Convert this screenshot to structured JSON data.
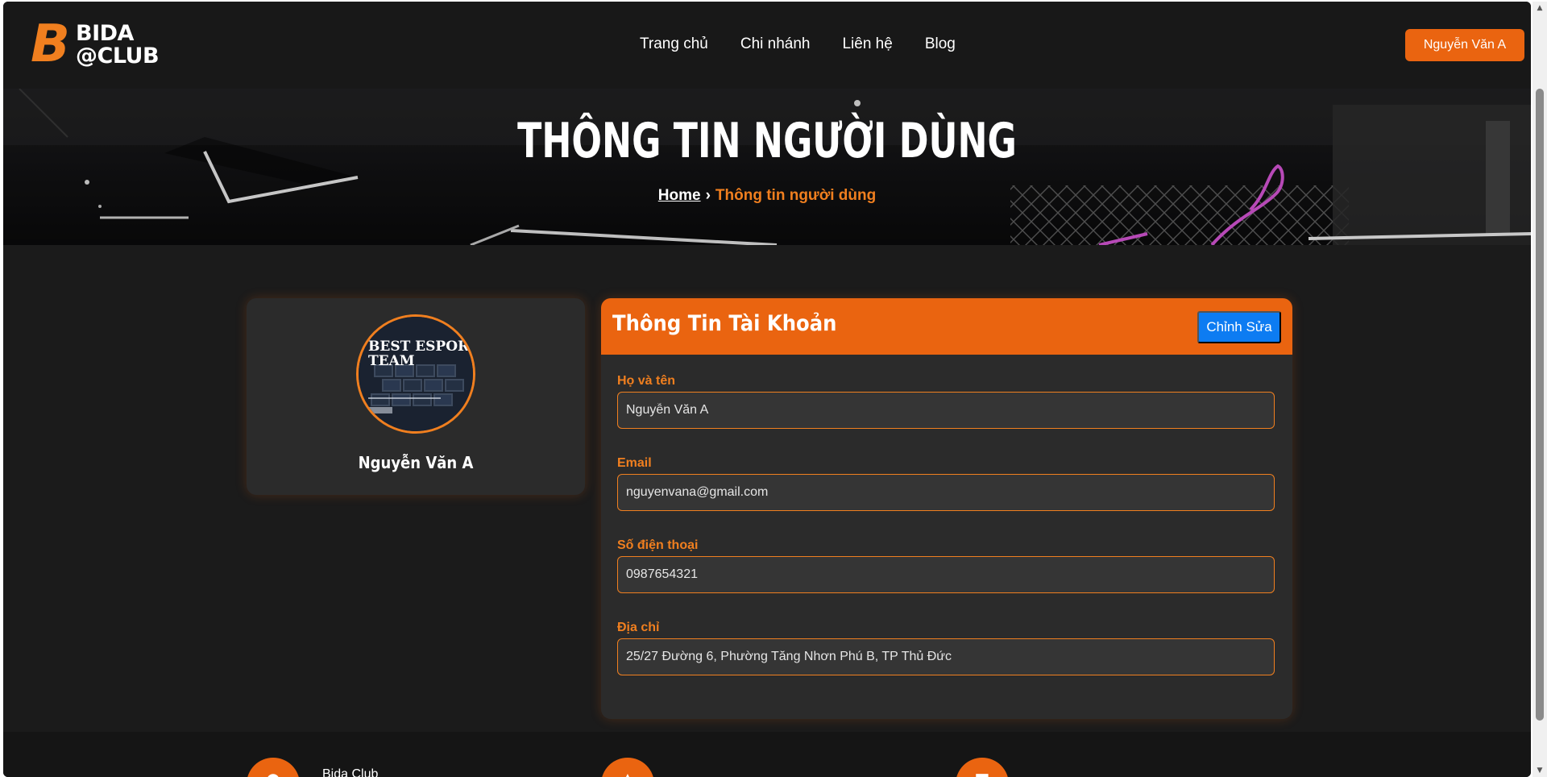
{
  "brand": {
    "logo_mark": "B",
    "logo_line1": "BIDA",
    "logo_line2": "@CLUB"
  },
  "nav": {
    "items": [
      {
        "label": "Trang chủ"
      },
      {
        "label": "Chi nhánh"
      },
      {
        "label": "Liên hệ"
      },
      {
        "label": "Blog"
      }
    ],
    "user_button": "Nguyễn Văn A"
  },
  "hero": {
    "title": "THÔNG TIN NGƯỜI DÙNG",
    "breadcrumb": {
      "home": "Home",
      "separator": "›",
      "current": "Thông tin người dùng"
    }
  },
  "profile": {
    "name": "Nguyễn Văn A",
    "avatar_text_line1": "BEST ESPORT",
    "avatar_text_line2": "TEAM"
  },
  "account": {
    "title": "Thông Tin Tài Khoản",
    "edit_button": "Chỉnh Sửa",
    "fields": [
      {
        "label": "Họ và tên",
        "value": "Nguyễn Văn A"
      },
      {
        "label": "Email",
        "value": "nguyenvana@gmail.com"
      },
      {
        "label": "Số điện thoại",
        "value": "0987654321"
      },
      {
        "label": "Địa chỉ",
        "value": "25/27 Đường 6, Phường Tăng Nhơn Phú B, TP Thủ Đức"
      }
    ]
  },
  "footer": {
    "club_name": "Bida Club",
    "icons": [
      "location-icon",
      "phone-icon",
      "mail-icon"
    ]
  },
  "colors": {
    "accent": "#ea6410",
    "accent_text": "#f07f1f",
    "edit_button": "#0d7cf2",
    "background": "#1b1b1b",
    "card": "#2b2b2b"
  }
}
